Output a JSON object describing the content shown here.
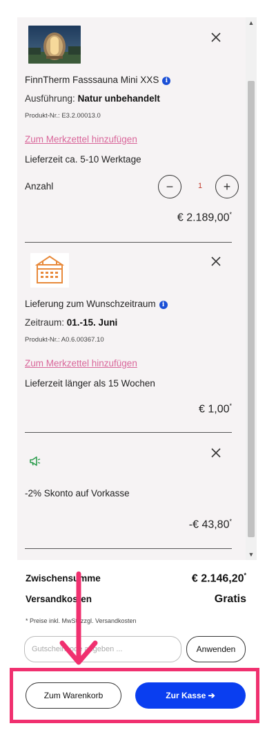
{
  "cart": {
    "items": [
      {
        "title": "FinnTherm Fasssauna Mini XXS",
        "variant_label": "Ausführung:",
        "variant_value": "Natur unbehandelt",
        "sku": "Produkt-Nr.: E3.2.00013.0",
        "wishlist_label": "Zum Merkzettel hinzufügen",
        "delivery": "Lieferzeit ca. 5-10 Werktage",
        "quantity_label": "Anzahl",
        "quantity": "1",
        "price": "€ 2.189,00",
        "price_mark": "*"
      },
      {
        "title": "Lieferung zum Wunschzeitraum",
        "variant_label": "Zeitraum:",
        "variant_value": "01.-15. Juni",
        "sku": "Produkt-Nr.: A0.6.00367.10",
        "wishlist_label": "Zum Merkzettel hinzufügen",
        "delivery": "Lieferzeit länger als 15 Wochen",
        "price": "€ 1,00",
        "price_mark": "*"
      },
      {
        "title": "-2% Skonto auf Vorkasse",
        "price": "-€ 43,80",
        "price_mark": "*"
      }
    ]
  },
  "summary": {
    "subtotal_label": "Zwischensumme",
    "subtotal_value": "€ 2.146,20",
    "subtotal_mark": "*",
    "shipping_label": "Versandkosten",
    "shipping_value": "Gratis",
    "vat_note": "* Preise inkl. MwSt. zzgl. Versandkosten"
  },
  "voucher": {
    "placeholder": "Gutscheincode angeben ...",
    "apply_label": "Anwenden"
  },
  "actions": {
    "cart_label": "Zum Warenkorb",
    "checkout_label": "Zur Kasse ➔"
  },
  "colors": {
    "checkout": "#0a3ef0",
    "annotation": "#f0306f",
    "wishlist_link": "#d9669a",
    "info": "#1a4fd6",
    "promo_icon": "#2e9e4f",
    "calendar": "#e8893a"
  },
  "icons": {
    "remove": "close-icon",
    "info": "info-icon",
    "promo": "megaphone-icon",
    "delivery_product": "calendar-icon"
  }
}
